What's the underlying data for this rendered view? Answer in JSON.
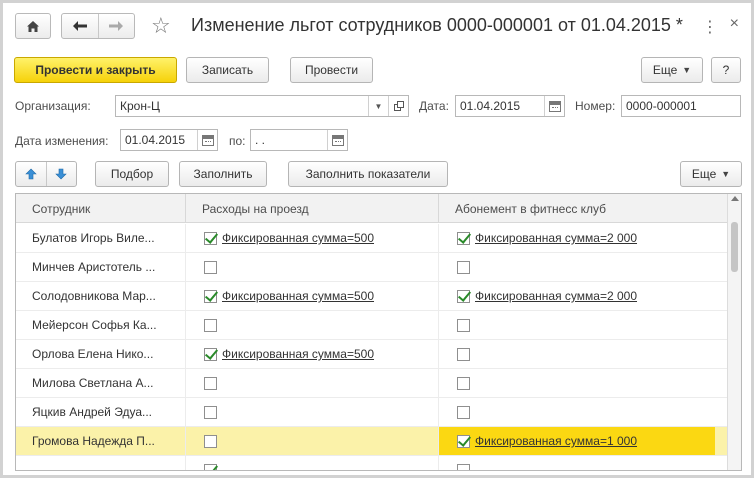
{
  "window": {
    "title": "Изменение льгот сотрудников 0000-000001 от 01.04.2015 *",
    "more_dots": "⋮",
    "close": "×"
  },
  "toolbar": {
    "post_close": "Провести и закрыть",
    "save": "Записать",
    "post": "Провести",
    "more": "Еще",
    "help": "?"
  },
  "form": {
    "org_label": "Организация:",
    "org_value": "Крон-Ц",
    "date_label": "Дата:",
    "date_value": "01.04.2015",
    "number_label": "Номер:",
    "number_value": "0000-000001",
    "change_date_label": "Дата изменения:",
    "change_date_value": "01.04.2015",
    "to_label": "по:",
    "to_value": " .  ."
  },
  "table_toolbar": {
    "select": "Подбор",
    "fill": "Заполнить",
    "fill_indicators": "Заполнить показатели",
    "more": "Еще"
  },
  "table": {
    "headers": [
      "Сотрудник",
      "Расходы на проезд",
      "Абонемент в фитнесс клуб"
    ],
    "rows": [
      {
        "name": "Булатов Игорь Виле...",
        "c2_checked": true,
        "c2_text": "Фиксированная сумма=500",
        "c3_checked": true,
        "c3_text": "Фиксированная сумма=2 000"
      },
      {
        "name": "Минчев Аристотель ...",
        "c2_checked": false,
        "c2_text": "",
        "c3_checked": false,
        "c3_text": ""
      },
      {
        "name": "Солодовникова Мар...",
        "c2_checked": true,
        "c2_text": "Фиксированная сумма=500",
        "c3_checked": true,
        "c3_text": "Фиксированная сумма=2 000"
      },
      {
        "name": "Мейерсон Софья Ка...",
        "c2_checked": false,
        "c2_text": "",
        "c3_checked": false,
        "c3_text": ""
      },
      {
        "name": "Орлова Елена Нико...",
        "c2_checked": true,
        "c2_text": "Фиксированная сумма=500",
        "c3_checked": false,
        "c3_text": ""
      },
      {
        "name": "Милова Светлана А...",
        "c2_checked": false,
        "c2_text": "",
        "c3_checked": false,
        "c3_text": ""
      },
      {
        "name": "Яцкив Андрей Эдуа...",
        "c2_checked": false,
        "c2_text": "",
        "c3_checked": false,
        "c3_text": ""
      },
      {
        "name": "Громова Надежда П...",
        "c2_checked": false,
        "c2_text": "",
        "c3_checked": true,
        "c3_text": "Фиксированная сумма=1 000",
        "selected": true
      },
      {
        "name": "",
        "c2_checked": true,
        "c2_text": "",
        "c3_checked": false,
        "c3_text": ""
      }
    ]
  }
}
